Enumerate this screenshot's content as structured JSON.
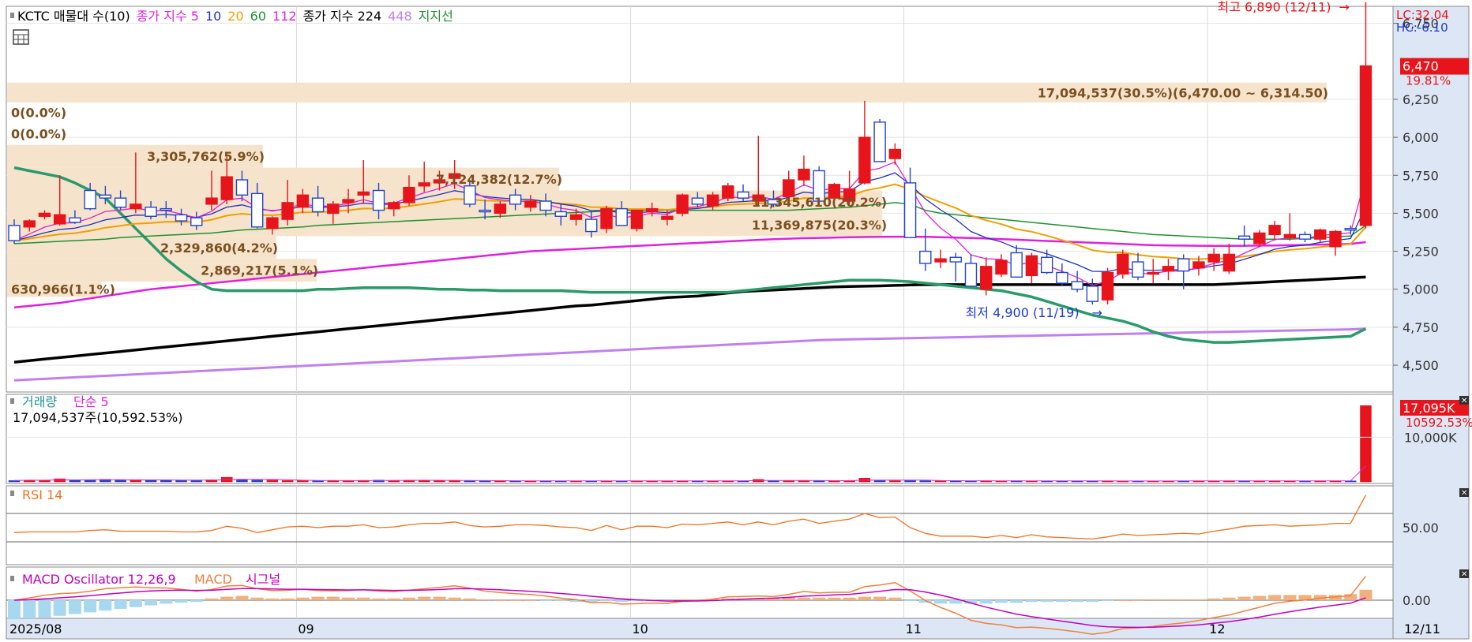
{
  "colors": {
    "up": "#e8141b",
    "down": "#2545c8",
    "ma5": "#e020d8",
    "ma10": "#2030c0",
    "ma20": "#f0a000",
    "ma60": "#209030",
    "ma112": "#e020e0",
    "ma224": "#000000",
    "ma448": "#c080f0",
    "support": "#2a9a6a",
    "volume_band": "#f6e3cc",
    "rsi": "#f07020",
    "macd": "#f08040",
    "signal": "#c000c0",
    "osc_pos": "#f0b080",
    "osc_neg": "#a8d8f0"
  },
  "price_panel": {
    "legend": [
      {
        "text": "KCTC 매물대 수(10)",
        "color": "#000000"
      },
      {
        "text": "종가 지수 5",
        "color": "#e020d8"
      },
      {
        "text": "10",
        "color": "#2030c0"
      },
      {
        "text": "20",
        "color": "#f0a000"
      },
      {
        "text": "60",
        "color": "#209030"
      },
      {
        "text": "112",
        "color": "#e020e0"
      },
      {
        "text": "종가 지수 224",
        "color": "#000000"
      },
      {
        "text": "448",
        "color": "#c080f0"
      },
      {
        "text": "지지선",
        "color": "#209030"
      }
    ],
    "ymin": 4360,
    "ymax": 6800,
    "y_ticks": [
      4500,
      4750,
      5000,
      5250,
      5500,
      5750,
      6000,
      6250,
      6750
    ],
    "y_tick_labels": [
      "4,500",
      "4,750",
      "5,000",
      "5,250",
      "5,500",
      "5,750",
      "6,000",
      "6,250",
      "6,750"
    ],
    "lc_label": "LC:32.04",
    "hc_label": "HC:-6.10",
    "current_price": 6470,
    "current_price_label": "6,470",
    "change_pct_label": "19.81%",
    "high_label": "최고 6,890 (12/11)",
    "high_value": 6890,
    "low_label": "최저 4,900 (11/19)",
    "low_value": 4900,
    "low_index": 72,
    "volume_profile": [
      {
        "label": "630,966(1.1%)",
        "low": 4950,
        "high": 5050,
        "width": 0.07
      },
      {
        "label": "2,869,217(5.1%)",
        "low": 5050,
        "high": 5200,
        "width": 0.23
      },
      {
        "label": "2,329,860(4.2%)",
        "low": 5200,
        "high": 5350,
        "width": 0.2
      },
      {
        "label": "11,369,875(20.3%)",
        "low": 5350,
        "high": 5500,
        "width": 0.65
      },
      {
        "label": "11,345,610(20.2%)",
        "low": 5500,
        "high": 5650,
        "width": 0.65
      },
      {
        "label": "7,124,382(12.7%)",
        "low": 5650,
        "high": 5800,
        "width": 0.41
      },
      {
        "label": "3,305,762(5.9%)",
        "low": 5800,
        "high": 5950,
        "width": 0.19
      },
      {
        "label": "0(0.0%)",
        "low": 5950,
        "high": 6100,
        "width": 0
      },
      {
        "label": "0(0.0%)",
        "low": 6100,
        "high": 6230,
        "width": 0
      },
      {
        "label": "17,094,537(30.5%)(6,470.00 ~ 6,314.50)",
        "low": 6230,
        "high": 6360,
        "width": 0.98
      }
    ]
  },
  "volume_panel": {
    "legend_a": "거래량",
    "legend_b": "단순 5",
    "info": "17,094,537주(10,592.53%)",
    "ymax": 17500000,
    "y_tick_label": "10,000K",
    "y_tick_value": 10000000,
    "badge_label": "17,095K",
    "badge_pct": "10592.53%"
  },
  "rsi_panel": {
    "legend": "RSI 14",
    "y_tick_label": "50.00",
    "upper_level": 70,
    "lower_level": 30
  },
  "macd_panel": {
    "legend_a": "MACD Oscillator 12,26,9",
    "legend_b": "MACD",
    "legend_c": "시그널",
    "y_tick_label": "0.00"
  },
  "x_axis": {
    "labels": [
      {
        "text": "2025/08",
        "index": 0
      },
      {
        "text": "09",
        "index": 19
      },
      {
        "text": "10",
        "index": 41
      },
      {
        "text": "11",
        "index": 59
      },
      {
        "text": "12",
        "index": 79
      }
    ],
    "end_label": "12/11"
  },
  "chart_data": {
    "type": "candlestick",
    "ohlc": [
      [
        5420,
        5460,
        5300,
        5320
      ],
      [
        5410,
        5460,
        5380,
        5450
      ],
      [
        5480,
        5520,
        5460,
        5500
      ],
      [
        5430,
        5750,
        5420,
        5490
      ],
      [
        5470,
        5520,
        5430,
        5440
      ],
      [
        5650,
        5700,
        5520,
        5530
      ],
      [
        5620,
        5680,
        5560,
        5600
      ],
      [
        5600,
        5650,
        5520,
        5540
      ],
      [
        5530,
        5900,
        5500,
        5560
      ],
      [
        5540,
        5580,
        5460,
        5480
      ],
      [
        5530,
        5580,
        5470,
        5520
      ],
      [
        5490,
        5530,
        5420,
        5450
      ],
      [
        5470,
        5510,
        5390,
        5420
      ],
      [
        5560,
        5780,
        5520,
        5600
      ],
      [
        5590,
        5880,
        5560,
        5740
      ],
      [
        5720,
        5780,
        5580,
        5620
      ],
      [
        5630,
        5700,
        5400,
        5410
      ],
      [
        5400,
        5480,
        5360,
        5470
      ],
      [
        5460,
        5720,
        5420,
        5570
      ],
      [
        5540,
        5660,
        5500,
        5620
      ],
      [
        5600,
        5680,
        5480,
        5510
      ],
      [
        5500,
        5580,
        5430,
        5560
      ],
      [
        5570,
        5660,
        5500,
        5590
      ],
      [
        5620,
        5850,
        5560,
        5640
      ],
      [
        5650,
        5700,
        5460,
        5520
      ],
      [
        5530,
        5580,
        5480,
        5570
      ],
      [
        5570,
        5750,
        5550,
        5670
      ],
      [
        5680,
        5840,
        5640,
        5700
      ],
      [
        5700,
        5780,
        5650,
        5720
      ],
      [
        5730,
        5850,
        5660,
        5760
      ],
      [
        5680,
        5720,
        5540,
        5560
      ],
      [
        5520,
        5590,
        5460,
        5510
      ],
      [
        5500,
        5580,
        5470,
        5560
      ],
      [
        5620,
        5660,
        5520,
        5560
      ],
      [
        5540,
        5620,
        5510,
        5580
      ],
      [
        5580,
        5630,
        5480,
        5520
      ],
      [
        5510,
        5560,
        5420,
        5480
      ],
      [
        5460,
        5530,
        5420,
        5490
      ],
      [
        5460,
        5520,
        5340,
        5380
      ],
      [
        5400,
        5550,
        5370,
        5530
      ],
      [
        5530,
        5580,
        5420,
        5420
      ],
      [
        5400,
        5520,
        5380,
        5520
      ],
      [
        5510,
        5570,
        5480,
        5530
      ],
      [
        5460,
        5520,
        5420,
        5480
      ],
      [
        5500,
        5630,
        5480,
        5620
      ],
      [
        5600,
        5640,
        5540,
        5560
      ],
      [
        5550,
        5640,
        5520,
        5620
      ],
      [
        5600,
        5700,
        5580,
        5680
      ],
      [
        5640,
        5690,
        5580,
        5600
      ],
      [
        5580,
        6010,
        5550,
        5620
      ],
      [
        5590,
        5650,
        5540,
        5560
      ],
      [
        5610,
        5780,
        5600,
        5720
      ],
      [
        5720,
        5880,
        5680,
        5790
      ],
      [
        5780,
        5810,
        5550,
        5580
      ],
      [
        5600,
        5700,
        5570,
        5690
      ],
      [
        5580,
        5780,
        5560,
        5660
      ],
      [
        5700,
        6240,
        5690,
        6000
      ],
      [
        6100,
        6120,
        5840,
        5840
      ],
      [
        5860,
        5960,
        5820,
        5920
      ],
      [
        5700,
        5800,
        5350,
        5340
      ],
      [
        5250,
        5400,
        5120,
        5170
      ],
      [
        5180,
        5260,
        5140,
        5200
      ],
      [
        5210,
        5240,
        5050,
        5180
      ],
      [
        5170,
        5230,
        5040,
        5020
      ],
      [
        5000,
        5210,
        4960,
        5150
      ],
      [
        5100,
        5230,
        5080,
        5190
      ],
      [
        5240,
        5290,
        5080,
        5080
      ],
      [
        5090,
        5240,
        5040,
        5220
      ],
      [
        5210,
        5260,
        5100,
        5110
      ],
      [
        5110,
        5170,
        5020,
        5040
      ],
      [
        5050,
        5120,
        4980,
        5000
      ],
      [
        5020,
        5070,
        4900,
        4920
      ],
      [
        4930,
        5140,
        4900,
        5110
      ],
      [
        5100,
        5260,
        5070,
        5230
      ],
      [
        5180,
        5240,
        5060,
        5080
      ],
      [
        5100,
        5200,
        5040,
        5110
      ],
      [
        5120,
        5200,
        5060,
        5150
      ],
      [
        5200,
        5230,
        5000,
        5120
      ],
      [
        5140,
        5220,
        5090,
        5180
      ],
      [
        5180,
        5270,
        5120,
        5230
      ],
      [
        5120,
        5300,
        5100,
        5230
      ],
      [
        5350,
        5420,
        5280,
        5330
      ],
      [
        5300,
        5390,
        5280,
        5370
      ],
      [
        5360,
        5450,
        5320,
        5420
      ],
      [
        5340,
        5500,
        5320,
        5360
      ],
      [
        5360,
        5380,
        5310,
        5330
      ],
      [
        5330,
        5400,
        5310,
        5390
      ],
      [
        5280,
        5390,
        5220,
        5380
      ],
      [
        5400,
        5420,
        5360,
        5390
      ],
      [
        5420,
        6890,
        5400,
        6470
      ]
    ],
    "volume": [
      320000,
      410000,
      390000,
      700000,
      380000,
      420000,
      560000,
      390000,
      500000,
      380000,
      360000,
      410000,
      380000,
      480000,
      1050000,
      470000,
      390000,
      380000,
      300000,
      290000,
      260000,
      250000,
      280000,
      330000,
      410000,
      330000,
      390000,
      360000,
      300000,
      330000,
      240000,
      220000,
      260000,
      230000,
      210000,
      240000,
      220000,
      200000,
      230000,
      210000,
      220000,
      190000,
      210000,
      200000,
      230000,
      240000,
      230000,
      240000,
      250000,
      560000,
      240000,
      260000,
      270000,
      300000,
      270000,
      260000,
      840000,
      330000,
      270000,
      300000,
      280000,
      250000,
      230000,
      220000,
      230000,
      210000,
      260000,
      200000,
      210000,
      220000,
      200000,
      210000,
      180000,
      190000,
      220000,
      200000,
      210000,
      200000,
      220000,
      210000,
      230000,
      240000,
      220000,
      230000,
      210000,
      220000,
      230000,
      240000,
      230000,
      17094537
    ],
    "ma224": [
      4520,
      4530,
      4540,
      4550,
      4560,
      4570,
      4580,
      4590,
      4600,
      4610,
      4620,
      4630,
      4640,
      4650,
      4660,
      4670,
      4680,
      4690,
      4700,
      4710,
      4720,
      4730,
      4740,
      4750,
      4760,
      4770,
      4780,
      4790,
      4800,
      4810,
      4820,
      4830,
      4840,
      4850,
      4860,
      4870,
      4880,
      4890,
      4895,
      4905,
      4915,
      4925,
      4935,
      4945,
      4950,
      4955,
      4965,
      4975,
      4985,
      4990,
      4995,
      5000,
      5005,
      5010,
      5015,
      5018,
      5020,
      5022,
      5025,
      5028,
      5030,
      5030,
      5030,
      5030,
      5030,
      5030,
      5030,
      5030,
      5030,
      5030,
      5030,
      5030,
      5030,
      5030,
      5030,
      5030,
      5030,
      5030,
      5030,
      5030,
      5035,
      5040,
      5045,
      5050,
      5055,
      5060,
      5065,
      5070,
      5075,
      5080
    ],
    "ma448": [
      4400,
      4405,
      4410,
      4415,
      4420,
      4425,
      4430,
      4435,
      4440,
      4445,
      4450,
      4455,
      4460,
      4465,
      4470,
      4475,
      4480,
      4485,
      4490,
      4495,
      4500,
      4505,
      4510,
      4515,
      4520,
      4525,
      4530,
      4535,
      4540,
      4545,
      4550,
      4555,
      4560,
      4565,
      4570,
      4575,
      4580,
      4585,
      4590,
      4595,
      4600,
      4605,
      4610,
      4615,
      4620,
      4625,
      4630,
      4635,
      4640,
      4645,
      4650,
      4655,
      4660,
      4665,
      4668,
      4670,
      4672,
      4674,
      4676,
      4678,
      4680,
      4682,
      4684,
      4686,
      4688,
      4690,
      4692,
      4694,
      4696,
      4698,
      4700,
      4702,
      4704,
      4706,
      4708,
      4710,
      4712,
      4714,
      4716,
      4718,
      4720,
      4722,
      4724,
      4726,
      4728,
      4730,
      4732,
      4734,
      4736,
      4740
    ],
    "ma112": [
      4880,
      4890,
      4900,
      4910,
      4925,
      4940,
      4955,
      4970,
      4985,
      5000,
      5010,
      5020,
      5030,
      5040,
      5050,
      5060,
      5070,
      5080,
      5090,
      5100,
      5110,
      5120,
      5130,
      5140,
      5150,
      5160,
      5170,
      5180,
      5190,
      5200,
      5210,
      5220,
      5230,
      5240,
      5250,
      5255,
      5260,
      5265,
      5270,
      5275,
      5280,
      5285,
      5290,
      5295,
      5300,
      5305,
      5310,
      5315,
      5320,
      5325,
      5330,
      5333,
      5336,
      5338,
      5340,
      5342,
      5344,
      5345,
      5346,
      5346,
      5345,
      5343,
      5340,
      5337,
      5334,
      5330,
      5326,
      5322,
      5318,
      5314,
      5310,
      5306,
      5302,
      5298,
      5294,
      5290,
      5288,
      5287,
      5286,
      5285,
      5285,
      5286,
      5287,
      5288,
      5290,
      5292,
      5294,
      5296,
      5298,
      5310
    ],
    "support": [
      5800,
      5780,
      5760,
      5740,
      5700,
      5650,
      5600,
      5500,
      5400,
      5300,
      5200,
      5120,
      5050,
      5000,
      4990,
      4990,
      4990,
      4990,
      4990,
      4990,
      5000,
      5000,
      5005,
      5010,
      5010,
      5010,
      5010,
      5005,
      5000,
      5000,
      4995,
      4995,
      4990,
      4990,
      4990,
      4990,
      4990,
      4985,
      4980,
      4980,
      4980,
      4980,
      4980,
      4980,
      4980,
      4980,
      4980,
      4980,
      4990,
      5000,
      5010,
      5020,
      5030,
      5040,
      5050,
      5060,
      5060,
      5060,
      5055,
      5050,
      5040,
      5030,
      5020,
      5010,
      5000,
      4990,
      4970,
      4950,
      4920,
      4890,
      4860,
      4830,
      4810,
      4790,
      4760,
      4720,
      4690,
      4670,
      4660,
      4650,
      4650,
      4655,
      4660,
      4665,
      4670,
      4675,
      4680,
      4685,
      4690,
      4740
    ],
    "ma60": [
      5300,
      5305,
      5310,
      5315,
      5320,
      5325,
      5330,
      5340,
      5345,
      5350,
      5355,
      5360,
      5365,
      5370,
      5380,
      5390,
      5395,
      5400,
      5405,
      5410,
      5420,
      5425,
      5430,
      5435,
      5440,
      5445,
      5450,
      5455,
      5460,
      5465,
      5470,
      5475,
      5480,
      5485,
      5490,
      5495,
      5500,
      5505,
      5510,
      5515,
      5520,
      5520,
      5520,
      5520,
      5520,
      5520,
      5520,
      5520,
      5520,
      5520,
      5520,
      5520,
      5525,
      5530,
      5535,
      5540,
      5550,
      5560,
      5570,
      5560,
      5520,
      5500,
      5490,
      5480,
      5470,
      5460,
      5450,
      5440,
      5430,
      5420,
      5410,
      5400,
      5390,
      5380,
      5370,
      5360,
      5355,
      5350,
      5345,
      5340,
      5335,
      5330,
      5330,
      5330,
      5330,
      5335,
      5340,
      5345,
      5350,
      5420
    ],
    "rsi": [
      43,
      44,
      44,
      44,
      44,
      46,
      47,
      45,
      45,
      45,
      45,
      44,
      44,
      46,
      52,
      49,
      43,
      47,
      51,
      52,
      50,
      52,
      52,
      54,
      50,
      51,
      54,
      56,
      56,
      58,
      53,
      51,
      52,
      54,
      54,
      53,
      51,
      50,
      46,
      53,
      47,
      52,
      52,
      50,
      55,
      54,
      56,
      58,
      54,
      58,
      54,
      59,
      62,
      56,
      59,
      62,
      70,
      64,
      65,
      50,
      42,
      38,
      38,
      38,
      36,
      39,
      36,
      40,
      37,
      36,
      35,
      34,
      37,
      41,
      39,
      40,
      41,
      42,
      41,
      45,
      48,
      52,
      53,
      54,
      52,
      53,
      54,
      56,
      56,
      96
    ],
    "macd_osc": [
      -22,
      -21,
      -20,
      -18,
      -16,
      -14,
      -12,
      -10,
      -8,
      -6,
      -4,
      -3,
      -2,
      2,
      4,
      5,
      3,
      2,
      2,
      3,
      4,
      4,
      3,
      3,
      2,
      2,
      3,
      4,
      4,
      3,
      2,
      1,
      0,
      0,
      0,
      -1,
      -1,
      -2,
      -2,
      -1,
      -2,
      -1,
      0,
      0,
      1,
      1,
      1,
      2,
      2,
      2,
      2,
      3,
      3,
      3,
      3,
      3,
      4,
      4,
      3,
      -1,
      -3,
      -4,
      -4,
      -4,
      -4,
      -3,
      -3,
      -2,
      -2,
      -2,
      -2,
      -2,
      -1,
      0,
      0,
      1,
      1,
      1,
      1,
      2,
      3,
      4,
      5,
      6,
      6,
      6,
      6,
      6,
      7,
      12
    ]
  }
}
